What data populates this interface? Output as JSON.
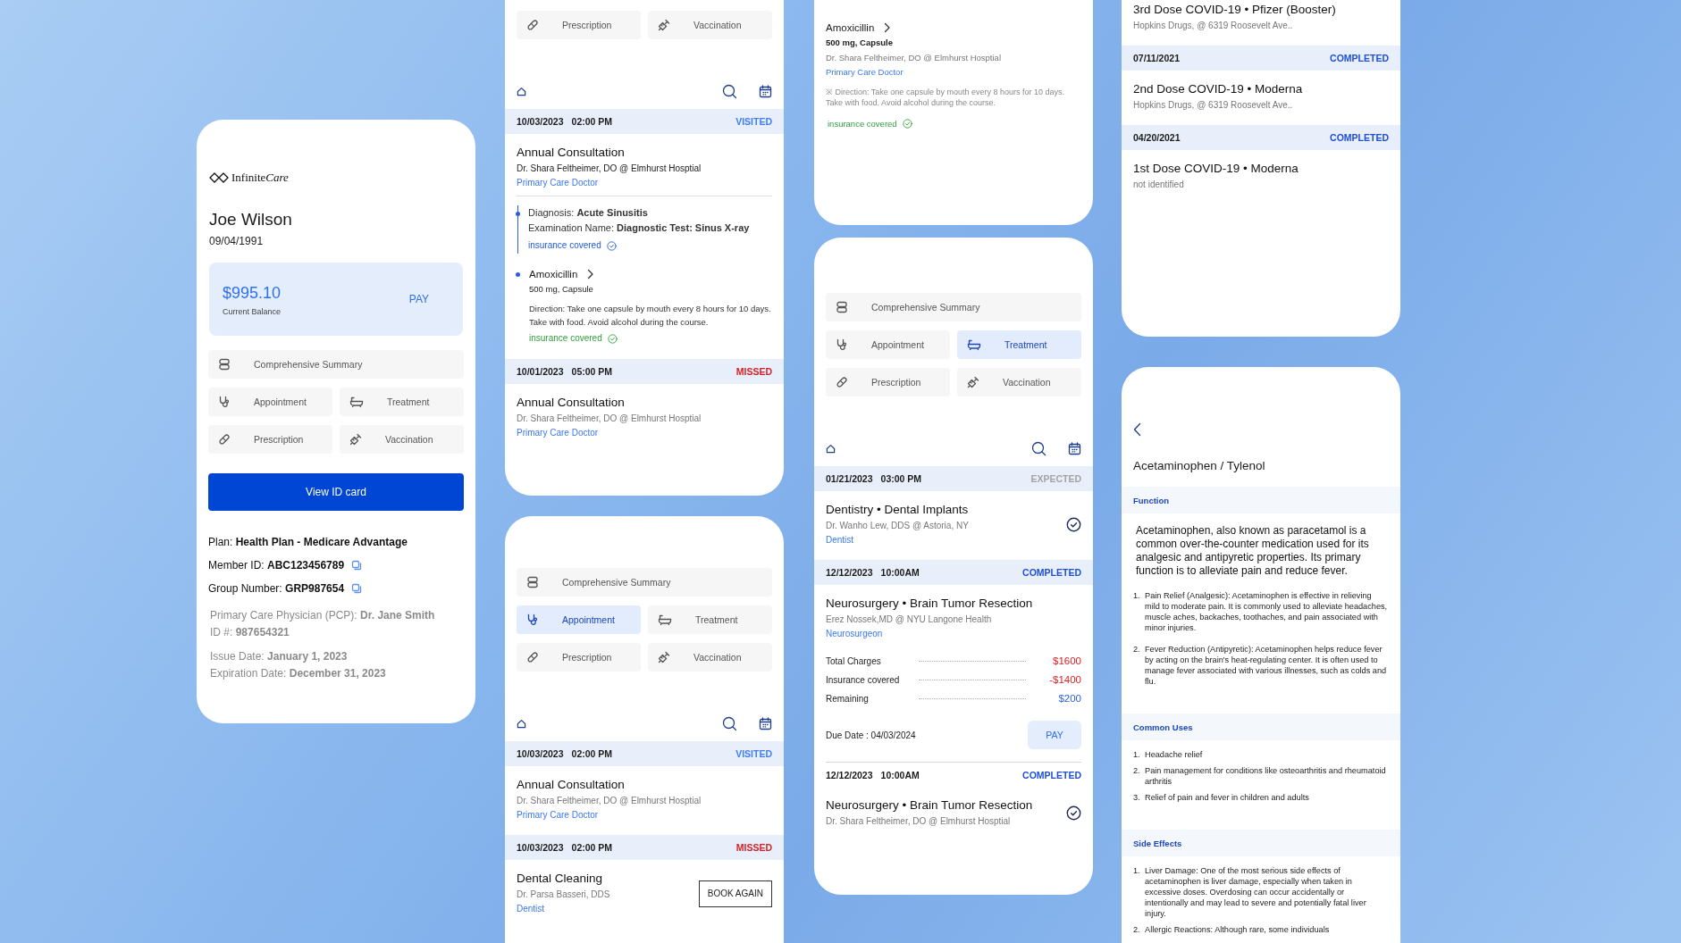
{
  "profile": {
    "brand": [
      "Infinite",
      "Care"
    ],
    "name": "Joe Wilson",
    "birth_date": "09/04/1991",
    "balance": {
      "amount": "$995.10",
      "label": "Current Balance",
      "pay_button": "PAY"
    },
    "menu": [
      {
        "kind": "summary",
        "label": "Comprehensive Summary",
        "selected": false
      },
      {
        "kind": "appointment",
        "label": "Appointment",
        "selected": false
      },
      {
        "kind": "treatment",
        "label": "Treatment",
        "selected": false
      },
      {
        "kind": "prescription",
        "label": "Prescription",
        "selected": false
      },
      {
        "kind": "vaccination",
        "label": "Vaccination",
        "selected": false
      }
    ],
    "id_card_button": "View ID card",
    "details": [
      {
        "muted": false,
        "lines": [
          {
            "text": "Plan: **Health Plan - Medicare Advantage**",
            "copyable": false
          },
          {
            "text": "Member ID: **ABC123456789**",
            "copyable": true
          },
          {
            "text": "Group Number: **GRP987654**",
            "copyable": true
          }
        ]
      },
      {
        "muted": true,
        "lines": [
          {
            "text": "Primary Care Physician (PCP): **Dr. Jane Smith**",
            "copyable": false
          },
          {
            "text": "ID #: **987654321**",
            "copyable": false
          }
        ]
      },
      {
        "muted": true,
        "lines": [
          {
            "text": "Issue Date: **January 1, 2023**",
            "copyable": false
          },
          {
            "text": "Expiration Date: **December 31, 2023**",
            "copyable": false
          }
        ]
      }
    ]
  },
  "appointment_history": {
    "menu": [
      {
        "kind": "prescription",
        "label": "Prescription",
        "selected": false
      },
      {
        "kind": "vaccination",
        "label": "Vaccination",
        "selected": false
      }
    ],
    "visits": [
      {
        "date": "10/03/2023",
        "time": "02:00 PM",
        "status": "VISITED",
        "color": "#3f7ef5",
        "banded": true,
        "title": "Annual Consultation",
        "provider": "Dr. Shara Feltheimer, DO @ Elmhurst Hosptial",
        "provider_dark": true,
        "role": "Primary Care Doctor",
        "timeline": [
          {
            "kind": "diagnosis",
            "lines": [
              "Diagnosis: **Acute Sinusitis**",
              "Examination Name: **Diagnostic Test: Sinus X-ray**"
            ],
            "coverage": "insurance covered"
          },
          {
            "kind": "prescription",
            "name": "Amoxicillin",
            "dosage": "500 mg, Capsule",
            "direction": "Direction: Take one capsule by mouth every 8 hours for 10 days. Take with food. Avoid alcohol during the course.",
            "coverage": "insurance covered"
          }
        ]
      },
      {
        "date": "10/01/2023",
        "time": "05:00 PM",
        "status": "MISSED",
        "color": "#d71f26",
        "banded": true,
        "title": "Annual Consultation",
        "provider": "Dr. Shara Feltheimer, DO @ Elmhurst Hosptial",
        "provider_dark": false,
        "role": "Primary Care Doctor"
      }
    ]
  },
  "appointments": {
    "menu": [
      {
        "kind": "summary",
        "label": "Comprehensive Summary",
        "selected": false
      },
      {
        "kind": "appointment",
        "label": "Appointment",
        "selected": true
      },
      {
        "kind": "treatment",
        "label": "Treatment",
        "selected": false
      },
      {
        "kind": "prescription",
        "label": "Prescription",
        "selected": false
      },
      {
        "kind": "vaccination",
        "label": "Vaccination",
        "selected": false
      }
    ],
    "visits": [
      {
        "date": "10/03/2023",
        "time": "02:00 PM",
        "status": "VISITED",
        "color": "#3f7ef5",
        "banded": true,
        "title": "Annual Consultation",
        "provider": "Dr. Shara Feltheimer, DO @ Elmhurst Hosptial",
        "role": "Primary Care Doctor"
      },
      {
        "date": "10/03/2023",
        "time": "02:00 PM",
        "status": "MISSED",
        "color": "#d71f26",
        "banded": true,
        "title": "Dental Cleaning",
        "provider": "Dr. Parsa Basseri, DDS",
        "role": "Dentist",
        "book_button": "BOOK AGAIN"
      }
    ]
  },
  "prescription_detail": {
    "name": "Amoxicillin",
    "dosage": "500 mg, Capsule",
    "provider": "Dr. Shara Feltheimer, DO @ Elmhurst Hosptial",
    "role": "Primary Care Doctor",
    "direction": "※ Direction: Take one capsule by mouth every 8 hours for 10 days. Take with food. Avoid alcohol during the course.",
    "coverage": "insurance covered"
  },
  "treatments": {
    "menu": [
      {
        "kind": "summary",
        "label": "Comprehensive Summary",
        "selected": false
      },
      {
        "kind": "appointment",
        "label": "Appointment",
        "selected": false
      },
      {
        "kind": "treatment",
        "label": "Treatment",
        "selected": true
      },
      {
        "kind": "prescription",
        "label": "Prescription",
        "selected": false
      },
      {
        "kind": "vaccination",
        "label": "Vaccination",
        "selected": false
      }
    ],
    "visits": [
      {
        "date": "01/21/2023",
        "time": "03:00 PM",
        "status": "EXPECTED",
        "color": "#a3a3a3",
        "banded": true,
        "title": "Dentistry • Dental Implants",
        "provider": "Dr. Wanho Lew, DDS @ Astoria, NY",
        "role": "Dentist",
        "checked": true
      },
      {
        "date": "12/12/2023",
        "time": "10:00AM",
        "status": "COMPLETED",
        "color": "#1d4fd8",
        "banded": true,
        "title": "Neurosurgery • Brain Tumor Resection",
        "provider": "Erez Nossek,MD @ NYU Langone Health",
        "role": "Neurosurgeon",
        "checked": false,
        "charges": [
          {
            "label": "Total Charges",
            "amount": "$1600",
            "kind": "charge"
          },
          {
            "label": "Insurance covered",
            "amount": "-$1400",
            "kind": "credit"
          },
          {
            "label": "Remaining",
            "amount": "$200",
            "kind": "remaining"
          }
        ],
        "due_date": "Due Date : 04/03/2024",
        "pay_button": "PAY"
      },
      {
        "date": "12/12/2023",
        "time": "10:00AM",
        "status": "COMPLETED",
        "color": "#1d4fd8",
        "banded": false,
        "title": "Neurosurgery • Brain Tumor Resection",
        "provider": "Dr. Shara Feltheimer, DO @ Elmhurst Hosptial",
        "checked": true
      }
    ]
  },
  "vaccinations": {
    "visits": [
      {
        "title": "3rd Dose COVID-19 • Pfizer (Booster)",
        "provider": "Hopkins Drugs, @ 6319 Roosevelt Ave.."
      },
      {
        "date": "07/11/2021",
        "status": "COMPLETED",
        "color": "#1d4fd8",
        "banded": true,
        "title": "2nd Dose COVID-19 • Moderna",
        "provider": "Hopkins Drugs, @ 6319 Roosevelt Ave.."
      },
      {
        "date": "04/20/2021",
        "status": "COMPLETED",
        "color": "#1d4fd8",
        "banded": true,
        "title": "1st Dose COVID-19 • Moderna",
        "provider": "not identified"
      }
    ]
  },
  "drug_info": {
    "title": "Acetaminophen / Tylenol",
    "sections": [
      {
        "heading": "Function",
        "paragraph": "Acetaminophen, also known as paracetamol is a common over-the-counter medication used for its analgesic and antipyretic properties. Its primary function is to alleviate pain and reduce fever.",
        "items": [
          {
            "number": "1.",
            "text": "Pain Relief (Analgesic): Acetaminophen is effective in relieving mild to moderate pain. It is commonly used to alleviate headaches, muscle aches, backaches, toothaches, and pain associated with minor injuries."
          },
          {
            "number": "2.",
            "text": "Fever Reduction (Antipyretic): Acetaminophen helps reduce fever by acting on the brain's heat-regulating center. It is often used to manage fever associated with various illnesses, such as colds and flu."
          }
        ]
      },
      {
        "heading": "Common Uses",
        "items": [
          {
            "number": "1.",
            "text": "Headache relief"
          },
          {
            "number": "2.",
            "text": "Pain management for conditions like osteoarthritis and rheumatoid arthritis"
          },
          {
            "number": "3.",
            "text": "Relief of pain and fever in children and adults"
          }
        ]
      },
      {
        "heading": "Side Effects",
        "items": [
          {
            "number": "1.",
            "text": "Liver Damage: One of the most serious side effects of acetaminophen is liver damage, especially when taken in excessive doses. Overdosing can occur accidentally or intentionally and may lead to severe and potentially fatal liver injury."
          },
          {
            "number": "2.",
            "text": "Allergic Reactions: Although rare, some individuals"
          }
        ]
      }
    ]
  }
}
